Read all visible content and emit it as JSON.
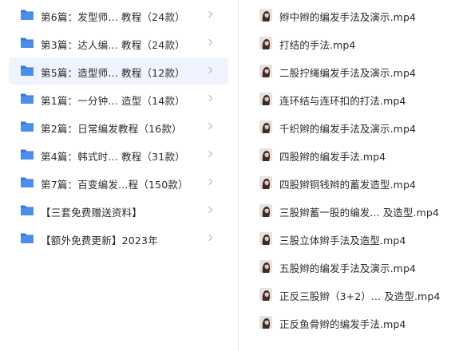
{
  "folders": [
    {
      "label": "第6篇：发型师...  教程（24款）",
      "selected": false
    },
    {
      "label": "第3篇：达人编...  教程（24款）",
      "selected": false
    },
    {
      "label": "第5篇：造型师...  教程（12款）",
      "selected": true
    },
    {
      "label": "第1篇：一分钟...  造型（14款）",
      "selected": false
    },
    {
      "label": "第2篇：日常编发教程（16款）",
      "selected": false
    },
    {
      "label": "第4篇：韩式时...  教程（31款）",
      "selected": false
    },
    {
      "label": "第7篇：百变编发...程（150款）",
      "selected": false
    },
    {
      "label": "【三套免费赠送资料】",
      "selected": false
    },
    {
      "label": "【额外免费更新】2023年",
      "selected": false
    }
  ],
  "files": [
    {
      "label": "辫中辫的编发手法及演示.mp4"
    },
    {
      "label": "打结的手法.mp4"
    },
    {
      "label": "二股拧绳编发手法及演示.mp4"
    },
    {
      "label": "连环结与连环扣的打法.mp4"
    },
    {
      "label": "千织辫的编发手法及演示.mp4"
    },
    {
      "label": "四股辫的编发手法.mp4"
    },
    {
      "label": "四股辫铜钱辫的蓄发造型.mp4"
    },
    {
      "label": "三股辫蓄一股的编发... 及造型.mp4"
    },
    {
      "label": "三股立体辫手法及造型.mp4"
    },
    {
      "label": "五股辫的编发手法及演示.mp4"
    },
    {
      "label": "正反三股辫（3+2）... 及造型.mp4"
    },
    {
      "label": "正反鱼骨辫的编发手法.mp4"
    }
  ],
  "colors": {
    "folder": "#4d8ee8",
    "folder_back": "#3576d8",
    "selected_bg": "#eef3fd",
    "chevron": "#b5b5b5"
  }
}
